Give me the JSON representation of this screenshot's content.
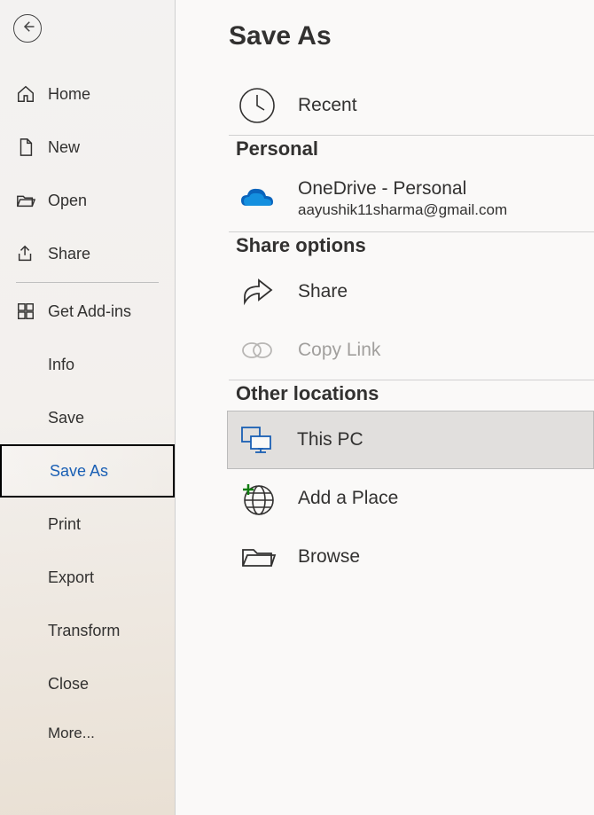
{
  "sidebar": {
    "items": [
      {
        "label": "Home"
      },
      {
        "label": "New"
      },
      {
        "label": "Open"
      },
      {
        "label": "Share"
      },
      {
        "label": "Get Add-ins"
      },
      {
        "label": "Info"
      },
      {
        "label": "Save"
      },
      {
        "label": "Save As"
      },
      {
        "label": "Print"
      },
      {
        "label": "Export"
      },
      {
        "label": "Transform"
      },
      {
        "label": "Close"
      },
      {
        "label": "More..."
      }
    ]
  },
  "main": {
    "title": "Save As",
    "recent": {
      "label": "Recent"
    },
    "personal": {
      "heading": "Personal",
      "onedrive": {
        "label": "OneDrive - Personal",
        "sublabel": "aayushik11sharma@gmail.com"
      }
    },
    "share_options": {
      "heading": "Share options",
      "share": {
        "label": "Share"
      },
      "copylink": {
        "label": "Copy Link"
      }
    },
    "other": {
      "heading": "Other locations",
      "thispc": {
        "label": "This PC"
      },
      "addplace": {
        "label": "Add a Place"
      },
      "browse": {
        "label": "Browse"
      }
    }
  }
}
